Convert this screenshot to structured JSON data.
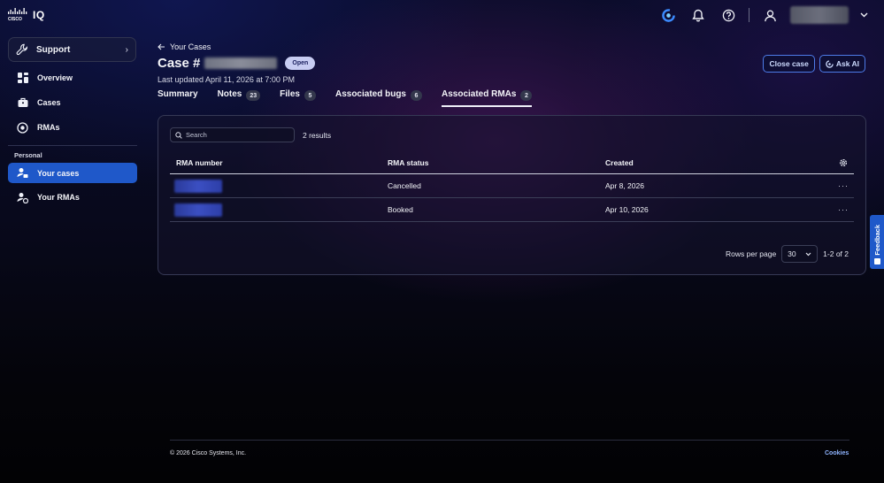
{
  "app": {
    "logo_text": "IQ"
  },
  "sidebar": {
    "support_label": "Support",
    "items": [
      {
        "label": "Overview",
        "icon": "dashboard-icon"
      },
      {
        "label": "Cases",
        "icon": "briefcase-icon"
      },
      {
        "label": "RMAs",
        "icon": "rma-icon"
      }
    ],
    "section_label": "Personal",
    "personal_items": [
      {
        "label": "Your cases",
        "icon": "user-case-icon",
        "active": true
      },
      {
        "label": "Your RMAs",
        "icon": "user-rma-icon",
        "active": false
      }
    ]
  },
  "header": {
    "back_label": "Your Cases",
    "case_prefix": "Case #",
    "status_badge": "Open",
    "last_updated": "Last updated April 11, 2026 at 7:00 PM",
    "close_case_label": "Close case",
    "ask_ai_label": "Ask AI"
  },
  "tabs": [
    {
      "label": "Summary",
      "count": null
    },
    {
      "label": "Notes",
      "count": "23"
    },
    {
      "label": "Files",
      "count": "5"
    },
    {
      "label": "Associated bugs",
      "count": "6"
    },
    {
      "label": "Associated RMAs",
      "count": "2",
      "active": true
    }
  ],
  "panel": {
    "search_placeholder": "Search",
    "results_text": "2 results",
    "columns": [
      "RMA number",
      "RMA status",
      "Created"
    ],
    "rows": [
      {
        "status": "Cancelled",
        "created": "Apr 8, 2026"
      },
      {
        "status": "Booked",
        "created": "Apr 10, 2026"
      }
    ],
    "rows_per_page_label": "Rows per page",
    "rows_per_page_value": "30",
    "range_text": "1-2 of 2"
  },
  "feedback_label": "Feedback",
  "footer": {
    "copyright": "© 2026 Cisco Systems, Inc.",
    "cookies": "Cookies"
  },
  "colors": {
    "accent": "#1f58c9",
    "link": "#8fb4ff",
    "button_border": "#4d7be8"
  }
}
